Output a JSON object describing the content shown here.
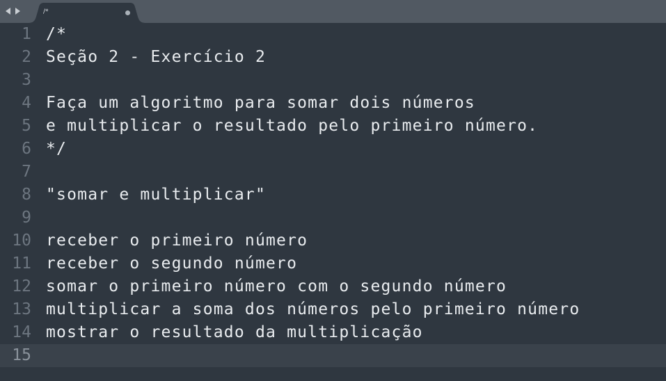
{
  "tab": {
    "title": "/*",
    "modified": true
  },
  "editor": {
    "current_line": 15,
    "lines": [
      {
        "number": "1",
        "text": "/*"
      },
      {
        "number": "2",
        "text": "Seção 2 - Exercício 2"
      },
      {
        "number": "3",
        "text": ""
      },
      {
        "number": "4",
        "text": "Faça um algoritmo para somar dois números"
      },
      {
        "number": "5",
        "text": "e multiplicar o resultado pelo primeiro número."
      },
      {
        "number": "6",
        "text": "*/"
      },
      {
        "number": "7",
        "text": ""
      },
      {
        "number": "8",
        "text": "\"somar e multiplicar\""
      },
      {
        "number": "9",
        "text": ""
      },
      {
        "number": "10",
        "text": "receber o primeiro número"
      },
      {
        "number": "11",
        "text": "receber o segundo número"
      },
      {
        "number": "12",
        "text": "somar o primeiro número com o segundo número"
      },
      {
        "number": "13",
        "text": "multiplicar a soma dos números pelo primeiro número"
      },
      {
        "number": "14",
        "text": "mostrar o resultado da multiplicação"
      },
      {
        "number": "15",
        "text": ""
      }
    ]
  },
  "colors": {
    "background": "#2f3740",
    "tabbar": "#515962",
    "text": "#e9ecef",
    "gutter": "#6d7680"
  }
}
